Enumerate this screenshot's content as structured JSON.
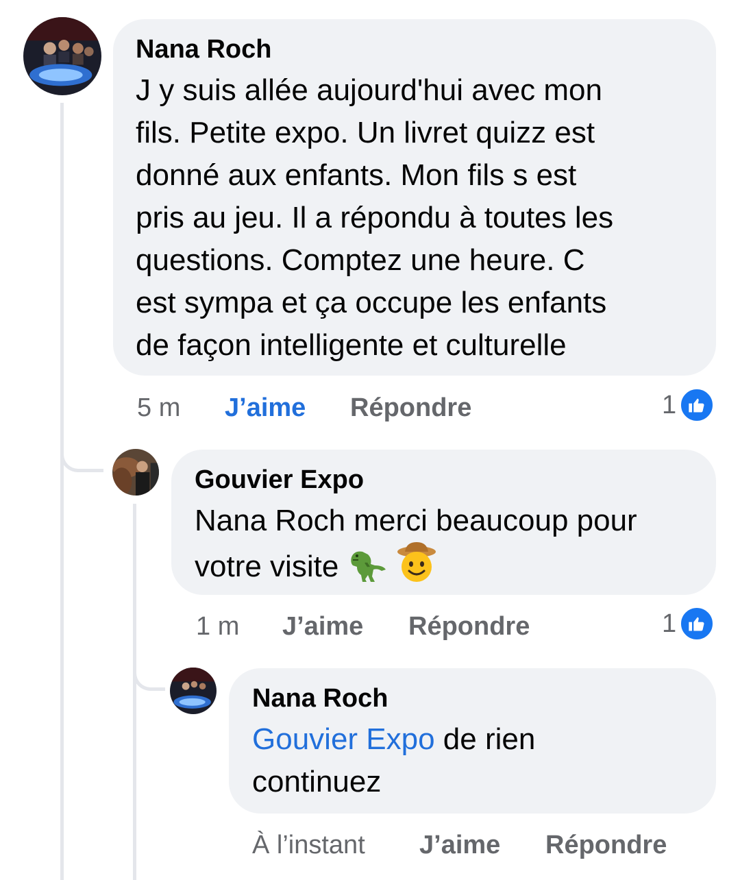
{
  "comments": [
    {
      "author": "Nana Roch",
      "lines": [
        "J y suis allée aujourd'hui avec mon",
        "fils. Petite expo. Un livret quizz est",
        "donné aux enfants. Mon fils s est",
        "pris au jeu. Il a répondu à toutes les",
        "questions. Comptez une heure. C",
        "est sympa et ça occupe les enfants",
        "de façon intelligente et culturelle"
      ],
      "time": "5 m",
      "like_label": "J’aime",
      "reply_label": "Répondre",
      "reaction_count": "1",
      "reaction_icon": "thumbs-up-icon"
    },
    {
      "author": "Gouvier Expo",
      "lines": [
        "Nana Roch merci beaucoup pour",
        "votre visite"
      ],
      "emojis": [
        "t-rex-emoji",
        "cowboy-face-emoji"
      ],
      "time": "1 m",
      "like_label": "J’aime",
      "reply_label": "Répondre",
      "reaction_count": "1",
      "reaction_icon": "thumbs-up-icon"
    },
    {
      "author": "Nana Roch",
      "mention": "Gouvier Expo",
      "line1_rest": " de rien",
      "line2": "continuez",
      "time": "À l’instant",
      "like_label": "J’aime",
      "reply_label": "Répondre"
    }
  ],
  "colors": {
    "bubble": "#f0f2f5",
    "link_blue": "#216fdb",
    "secondary_text": "#65676b",
    "like_badge": "#1877f2",
    "thread_line": "#e4e6eb"
  }
}
